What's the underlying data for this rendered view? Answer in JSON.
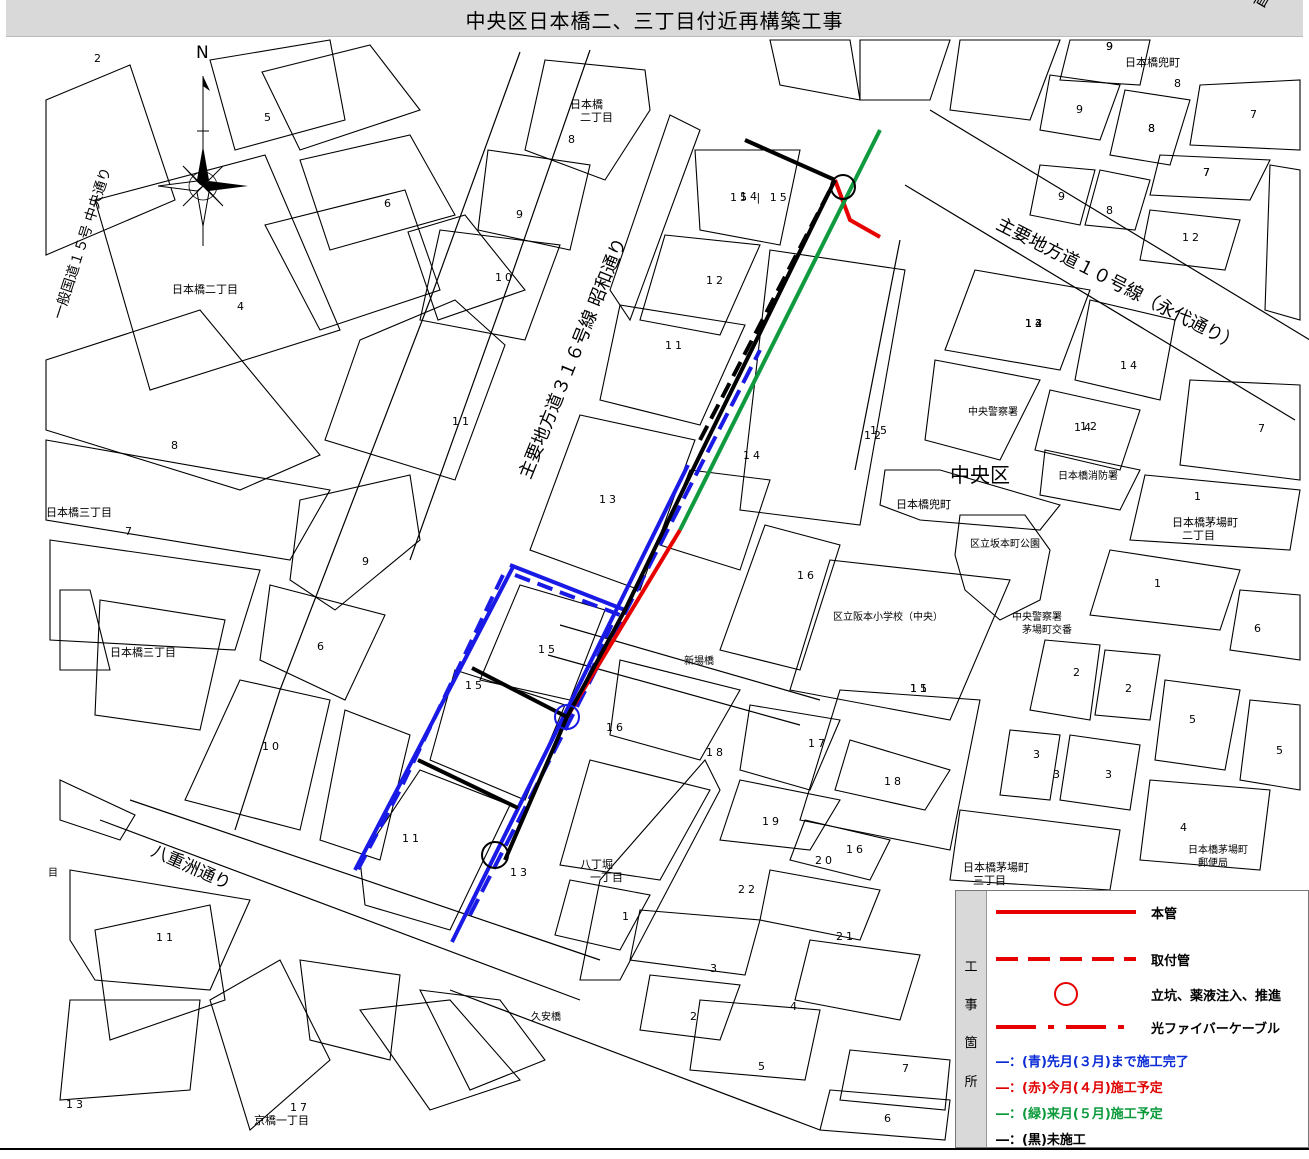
{
  "title": "中央区日本橋二、三丁目付近再構築工事",
  "corner_label": "首都",
  "compass": {
    "north_label": "N"
  },
  "roads": {
    "main_road_10": "主要地方道１０号線（永代通り）",
    "main_road_316": "主要地方道３１６号線 昭和通り",
    "national_road_15": "一般国道１５号 中央通り",
    "yaesu_dori": "八重洲通り"
  },
  "district_label": "中央区",
  "place_labels": [
    {
      "id": "nihonbashi-2chome-top",
      "text": "日本橋\n二丁目"
    },
    {
      "id": "nihonbashi-2chome",
      "text": "日本橋二丁目"
    },
    {
      "id": "nihonbashi-3chome-a",
      "text": "日本橋三丁目"
    },
    {
      "id": "nihonbashi-3chome-b",
      "text": "日本橋三丁目"
    },
    {
      "id": "kabutocho-top",
      "text": "日本橋兜町"
    },
    {
      "id": "kabutocho",
      "text": "日本橋兜町"
    },
    {
      "id": "kayabacho-2",
      "text": "日本橋茅場町\n二丁目"
    },
    {
      "id": "kayabacho-3",
      "text": "日本橋茅場町\n三丁目"
    },
    {
      "id": "hatchobori",
      "text": "八丁堀\n一丁目"
    },
    {
      "id": "kyobashi",
      "text": "京橋一丁目"
    },
    {
      "id": "police",
      "text": "中央警察署"
    },
    {
      "id": "fire",
      "text": "日本橋消防署"
    },
    {
      "id": "park",
      "text": "区立坂本町公園"
    },
    {
      "id": "school",
      "text": "区立阪本小学校（中央）"
    },
    {
      "id": "koban",
      "text": "中央警察署\n茅場町交番"
    },
    {
      "id": "post",
      "text": "日本橋茅場町\n郵便局"
    },
    {
      "id": "shinba",
      "text": "新場橋"
    },
    {
      "id": "kyuan",
      "text": "久安橋"
    },
    {
      "id": "me",
      "text": "目"
    }
  ],
  "block_numbers": [
    "2",
    "5",
    "6",
    "8",
    "9",
    "10",
    "11",
    "4",
    "8",
    "7",
    "9",
    "6",
    "10",
    "11",
    "12",
    "14",
    "13",
    "15",
    "16",
    "11",
    "13",
    "14",
    "12",
    "15",
    "12",
    "15",
    "16",
    "11",
    "18",
    "17",
    "19",
    "20",
    "22",
    "21",
    "16",
    "3",
    "2",
    "4",
    "1",
    "5",
    "7",
    "6",
    "18",
    "12",
    "11",
    "13",
    "17",
    "14",
    "9",
    "8",
    "9",
    "8",
    "7",
    "9",
    "8",
    "7",
    "12",
    "13",
    "14",
    "7",
    "1",
    "1",
    "6",
    "2",
    "2",
    "5",
    "5",
    "3",
    "3",
    "3",
    "15",
    "4",
    "14",
    "15 | 15",
    "9",
    "8",
    "7"
  ],
  "legend": {
    "side_chars": [
      "工",
      "事",
      "箇",
      "所"
    ],
    "items": [
      {
        "symbol": "solid",
        "label": "本管"
      },
      {
        "symbol": "dashed",
        "label": "取付管"
      },
      {
        "symbol": "circle",
        "label": "立坑、薬液注入、推進"
      },
      {
        "symbol": "dashdot",
        "label": "光ファイバーケーブル"
      }
    ],
    "status": [
      {
        "text": "―：(青)先月(３月)まで施工完了",
        "color": "#0a2bd6"
      },
      {
        "text": "―：(赤)今月(４月)施工予定",
        "color": "#e00000"
      },
      {
        "text": "―：(緑)来月(５月)施工予定",
        "color": "#0a9a3a"
      },
      {
        "text": "―：(黒)未施工",
        "color": "#000000"
      }
    ]
  },
  "colors": {
    "completed": "#1a1ae6",
    "this_month": "#e60000",
    "next_month": "#109a40",
    "not_started": "#000000",
    "title_bg": "#d9d9d9"
  }
}
